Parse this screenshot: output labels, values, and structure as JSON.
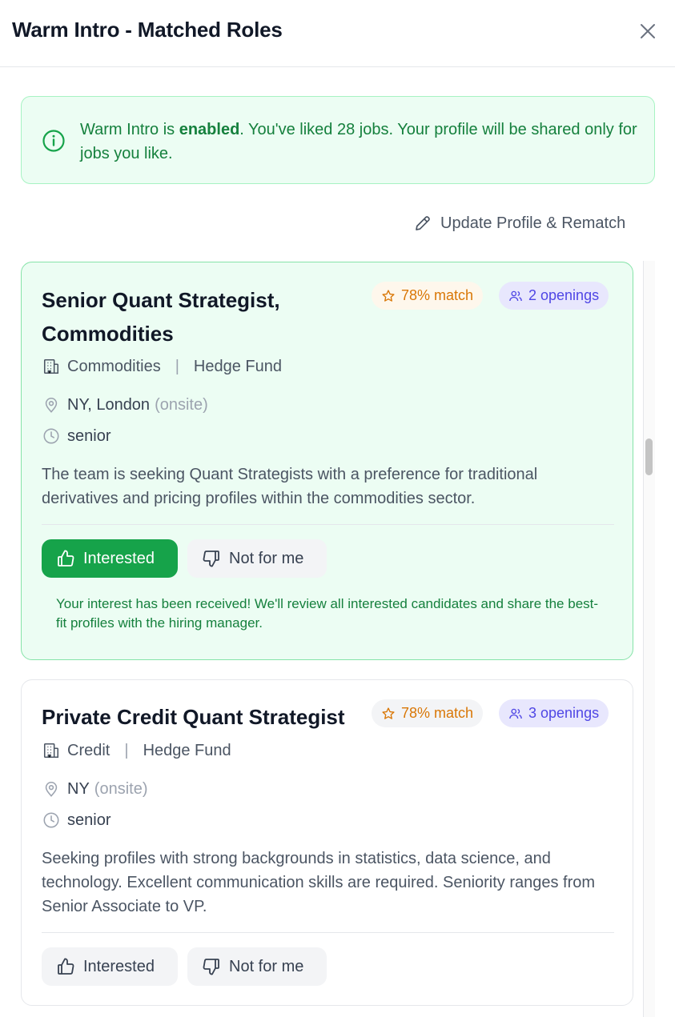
{
  "header": {
    "title": "Warm Intro - Matched Roles"
  },
  "notice": {
    "prefix": "Warm Intro is ",
    "status": "enabled",
    "suffix": ". You've liked 28 jobs. Your profile will be shared only for jobs you like."
  },
  "actions": {
    "update_label": "Update Profile & Rematch"
  },
  "jobs": [
    {
      "title": "Senior Quant Strategist, Commodities",
      "match": "78% match",
      "openings": "2 openings",
      "team": "Commodities",
      "firm_type": "Hedge Fund",
      "location": "NY, London",
      "work_mode": "(onsite)",
      "seniority": "senior",
      "description": "The team is seeking Quant Strategists with a preference for traditional derivatives and pricing profiles within the commodities sector.",
      "interested_label": "Interested",
      "not_for_me_label": "Not for me",
      "confirmation": "Your interest has been received! We'll review all interested candidates and share the best-fit profiles with the hiring manager."
    },
    {
      "title": "Private Credit Quant Strategist",
      "match": "78% match",
      "openings": "3 openings",
      "team": "Credit",
      "firm_type": "Hedge Fund",
      "location": "NY",
      "work_mode": "(onsite)",
      "seniority": "senior",
      "description": "Seeking profiles with strong backgrounds in statistics, data science, and technology. Excellent communication skills are required. Seniority ranges from Senior Associate to VP.",
      "interested_label": "Interested",
      "not_for_me_label": "Not for me"
    }
  ],
  "colors": {
    "success_green": "#16a34a",
    "notice_bg": "#ecfdf3",
    "match_orange": "#d97706",
    "openings_indigo": "#4f46e5"
  }
}
